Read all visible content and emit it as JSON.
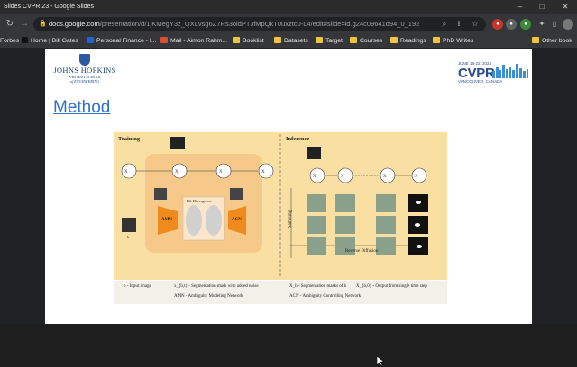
{
  "window": {
    "title": "Slides CVPR 23 - Google Slides"
  },
  "addressbar": {
    "host": "docs.google.com",
    "path": "/presentation/d/1jKMegY3z_QXLvsg6Z7Rs3oldPTJfMpQkT0uxztc0-L4/edit#slide=id.g24c09641d94_0_192"
  },
  "bookmarks": [
    {
      "label": "Forbes"
    },
    {
      "label": "Home | Bill Gates"
    },
    {
      "label": "Personal Finance - I..."
    },
    {
      "label": "Mail - Aimon Rahm..."
    },
    {
      "label": "Booklist"
    },
    {
      "label": "Datasets"
    },
    {
      "label": "Target"
    },
    {
      "label": "Courses"
    },
    {
      "label": "Readings"
    },
    {
      "label": "PhD Writes"
    },
    {
      "label": "Other book"
    }
  ],
  "slide": {
    "logo_left": {
      "line1": "JOHNS HOPKINS",
      "line2": "WHITING SCHOOL",
      "line3": "of ENGINEERING"
    },
    "logo_right": {
      "dates": "JUNE 18-22, 2023",
      "name": "CVPR",
      "location": "VANCOUVER, CANADA"
    },
    "heading": "Method",
    "figure": {
      "training_title": "Training",
      "inference_title": "Inference",
      "kl_label": "KL Divergence",
      "amn_label": "AMN",
      "acn_label": "ACN",
      "sampling_label": "Sampling",
      "reverse_label": "Reverse Diffusion",
      "b_label": "b",
      "x_t": "Xt",
      "x_t1": "Xt-1",
      "x_0": "X0",
      "x_T": "XT"
    },
    "caption": {
      "c1": "b  - Input image",
      "c2": "x_{b,t} - Segmentation mask with added noise",
      "c3": "AMN - Ambiguity Modeling Network",
      "c4": "X_b - Segmentation masks of b",
      "c5": "X_{b,0} - Output from single time step",
      "c6": "ACN - Ambiguity Controlling  Network"
    }
  },
  "colors": {
    "link_blue": "#3070c8",
    "figure_bg": "#f9dfa2",
    "jhu_blue": "#1f3f7a"
  }
}
